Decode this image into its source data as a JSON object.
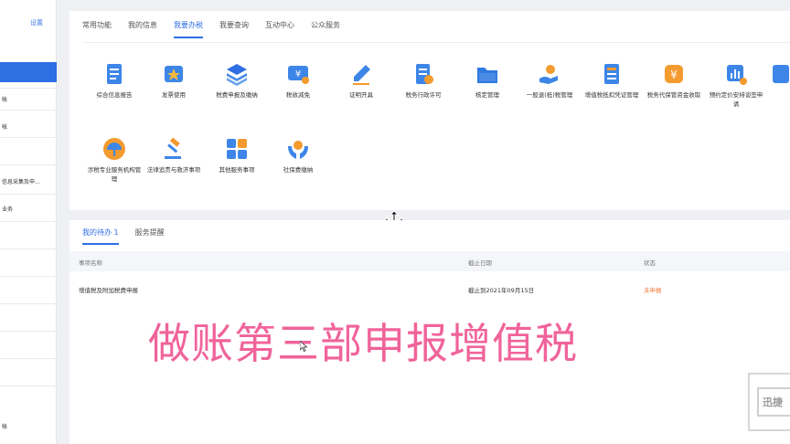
{
  "sidebar": {
    "setting_label": "设置",
    "items": [
      {
        "label": "帐"
      },
      {
        "label": "帐"
      },
      {
        "label": ""
      },
      {
        "label": "信息采集及申..."
      },
      {
        "label": "业务"
      },
      {
        "label": "帐"
      }
    ]
  },
  "top_tabs": [
    {
      "label": "常用功能"
    },
    {
      "label": "我的信息"
    },
    {
      "label": "我要办税"
    },
    {
      "label": "我要查询"
    },
    {
      "label": "互动中心"
    },
    {
      "label": "公众服务"
    }
  ],
  "services": [
    {
      "label": "综合信息报告",
      "icon": "document-list-icon",
      "color": "#3d86e8"
    },
    {
      "label": "发票使用",
      "icon": "invoice-star-icon",
      "color": "#3d86e8"
    },
    {
      "label": "税费申报及缴纳",
      "icon": "layers-icon",
      "color": "#4a8be6"
    },
    {
      "label": "税收减免",
      "icon": "yuan-ticket-icon",
      "color": "#3d86e8"
    },
    {
      "label": "证明开具",
      "icon": "pen-icon",
      "color": "#3d86e8"
    },
    {
      "label": "税务行政许可",
      "icon": "document-check-icon",
      "color": "#3d86e8"
    },
    {
      "label": "核定管理",
      "icon": "folder-icon",
      "color": "#2f7be0"
    },
    {
      "label": "一般退(抵)税管理",
      "icon": "hand-coin-icon",
      "color": "#f39b2f"
    },
    {
      "label": "增值税抵扣凭证管理",
      "icon": "ledger-icon",
      "color": "#3d86e8"
    },
    {
      "label": "税务代保管资金收取",
      "icon": "coin-icon",
      "color": "#f39b2f"
    },
    {
      "label": "预约定价安排谈签申请",
      "icon": "chart-coin-icon",
      "color": "#3d86e8"
    },
    {
      "label": "涉税专业服务机构管理",
      "icon": "umbrella-icon",
      "color": "#f39b2f"
    },
    {
      "label": "法律追责与救济事项",
      "icon": "gavel-icon",
      "color": "#f39b2f"
    },
    {
      "label": "其他服务事项",
      "icon": "grid-icon",
      "color": "#3d86e8"
    },
    {
      "label": "社保费缴纳",
      "icon": "hands-shield-icon",
      "color": "#3d86e8"
    }
  ],
  "bottom_tabs": [
    {
      "label": "我的待办 1"
    },
    {
      "label": "服务提醒"
    }
  ],
  "table": {
    "headers": [
      "事项名称",
      "截止日期",
      "状态"
    ],
    "rows": [
      {
        "name": "增值税及附加税费申报",
        "deadline": "截止到2021年09月15日",
        "status": "未申报"
      }
    ]
  },
  "caption": "做账第三部申报增值税",
  "watermark": "迅捷"
}
